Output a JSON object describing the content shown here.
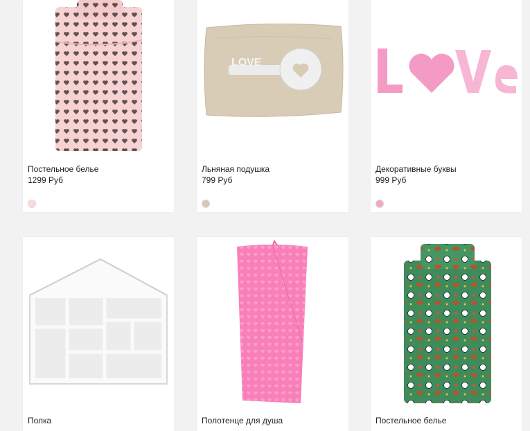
{
  "products": [
    {
      "name": "Постельное белье",
      "price": "1299 Руб",
      "swatch_color": "#f8ddd7",
      "image": "pink-hearts-bedding-image"
    },
    {
      "name": "Льняная подушка",
      "price": "799 Руб",
      "swatch_color": "#d6c8b2",
      "image": "linen-love-key-pillow-image"
    },
    {
      "name": "Декоративные буквы",
      "price": "999 Руб",
      "swatch_color": "#f4a6c8",
      "image": "love-letters-image"
    },
    {
      "name": "Полка",
      "image": "house-shelf-image"
    },
    {
      "name": "Полотенце для душа",
      "image": "pink-towel-image"
    },
    {
      "name": "Постельное белье",
      "image": "sports-bedding-image"
    }
  ],
  "image_text": {
    "pillow_word": "LOVE"
  },
  "colors": {
    "background": "#f2f2f2",
    "card": "#ffffff",
    "text": "#222222",
    "bedding_pink": "#f6d2d2",
    "heart_dark": "#4a3a3a",
    "linen": "#d9ccb6",
    "letters_pink": "#f49bc5",
    "towel_pink": "#f87fb8",
    "bedding_green": "#3e8b5c"
  }
}
